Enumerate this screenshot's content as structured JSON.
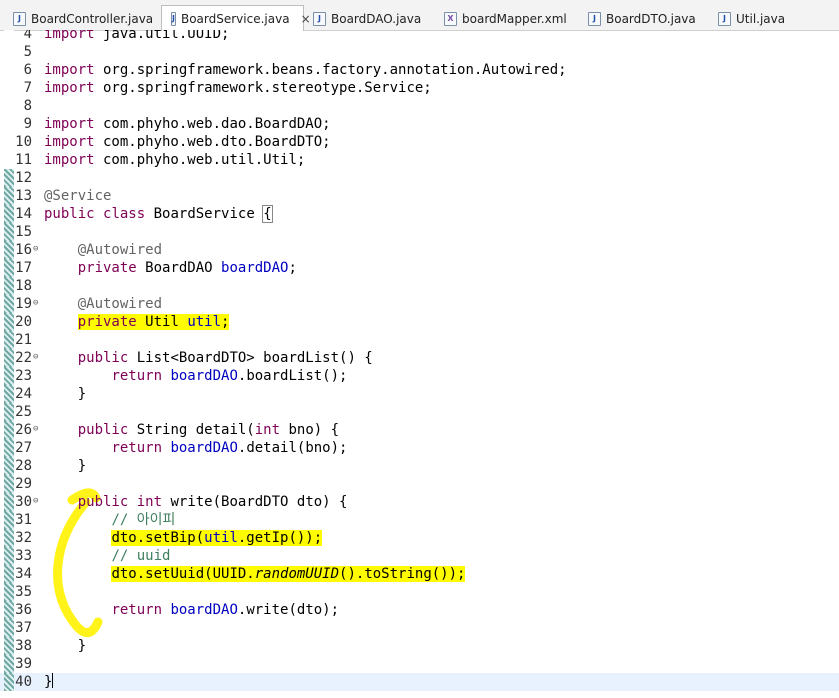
{
  "tabs": [
    {
      "label": "BoardController.java",
      "icon": "J",
      "active": false
    },
    {
      "label": "BoardService.java",
      "icon": "J",
      "active": true
    },
    {
      "label": "BoardDAO.java",
      "icon": "J",
      "active": false
    },
    {
      "label": "boardMapper.xml",
      "icon": "X",
      "active": false
    },
    {
      "label": "BoardDTO.java",
      "icon": "J",
      "active": false
    },
    {
      "label": "Util.java",
      "icon": "J",
      "active": false
    }
  ],
  "close_glyph": "×",
  "lines": [
    {
      "n": "4",
      "t": [
        [
          "kw",
          "import"
        ],
        [
          "",
          " java.util.UUID;"
        ]
      ]
    },
    {
      "n": "5",
      "t": []
    },
    {
      "n": "6",
      "t": [
        [
          "kw",
          "import"
        ],
        [
          "",
          " org.springframework.beans.factory.annotation.Autowired;"
        ]
      ]
    },
    {
      "n": "7",
      "t": [
        [
          "kw",
          "import"
        ],
        [
          "",
          " org.springframework.stereotype.Service;"
        ]
      ]
    },
    {
      "n": "8",
      "t": []
    },
    {
      "n": "9",
      "t": [
        [
          "kw",
          "import"
        ],
        [
          "",
          " com.phyho.web.dao.BoardDAO;"
        ]
      ]
    },
    {
      "n": "10",
      "t": [
        [
          "kw",
          "import"
        ],
        [
          "",
          " com.phyho.web.dto.BoardDTO;"
        ]
      ]
    },
    {
      "n": "11",
      "t": [
        [
          "kw",
          "import"
        ],
        [
          "",
          " com.phyho.web.util.Util;"
        ]
      ]
    },
    {
      "n": "12",
      "t": [],
      "mark": true
    },
    {
      "n": "13",
      "t": [
        [
          "ann",
          "@Service"
        ]
      ],
      "mark": true
    },
    {
      "n": "14",
      "t": [
        [
          "kw",
          "public"
        ],
        [
          "",
          " "
        ],
        [
          "kw",
          "class"
        ],
        [
          "",
          " BoardService "
        ],
        [
          "brk",
          "{"
        ]
      ],
      "mark": true
    },
    {
      "n": "15",
      "t": [],
      "mark": true
    },
    {
      "n": "16",
      "t": [
        [
          "",
          "    "
        ],
        [
          "ann",
          "@Autowired"
        ]
      ],
      "fold": true,
      "mark": true
    },
    {
      "n": "17",
      "t": [
        [
          "",
          "    "
        ],
        [
          "kw",
          "private"
        ],
        [
          "",
          " BoardDAO "
        ],
        [
          "fld",
          "boardDAO"
        ],
        [
          "",
          ";"
        ]
      ],
      "mark": true
    },
    {
      "n": "18",
      "t": [],
      "mark": true
    },
    {
      "n": "19",
      "t": [
        [
          "",
          "    "
        ],
        [
          "ann",
          "@Autowired"
        ]
      ],
      "fold": true,
      "mark": true
    },
    {
      "n": "20",
      "t": [
        [
          "",
          "    "
        ],
        [
          "kw hl",
          "private"
        ],
        [
          "hl",
          " Util "
        ],
        [
          "fld hl",
          "util"
        ],
        [
          "hl",
          ";"
        ]
      ],
      "mark": true
    },
    {
      "n": "21",
      "t": [],
      "mark": true
    },
    {
      "n": "22",
      "t": [
        [
          "",
          "    "
        ],
        [
          "kw",
          "public"
        ],
        [
          "",
          " List<BoardDTO> boardList() {"
        ]
      ],
      "fold": true,
      "mark": true
    },
    {
      "n": "23",
      "t": [
        [
          "",
          "        "
        ],
        [
          "kw",
          "return"
        ],
        [
          "",
          " "
        ],
        [
          "fld",
          "boardDAO"
        ],
        [
          "",
          ".boardList();"
        ]
      ],
      "mark": true
    },
    {
      "n": "24",
      "t": [
        [
          "",
          "    }"
        ]
      ],
      "mark": true
    },
    {
      "n": "25",
      "t": [],
      "mark": true
    },
    {
      "n": "26",
      "t": [
        [
          "",
          "    "
        ],
        [
          "kw",
          "public"
        ],
        [
          "",
          " String detail("
        ],
        [
          "kw",
          "int"
        ],
        [
          "",
          " bno) {"
        ]
      ],
      "fold": true,
      "mark": true
    },
    {
      "n": "27",
      "t": [
        [
          "",
          "        "
        ],
        [
          "kw",
          "return"
        ],
        [
          "",
          " "
        ],
        [
          "fld",
          "boardDAO"
        ],
        [
          "",
          ".detail(bno);"
        ]
      ],
      "mark": true
    },
    {
      "n": "28",
      "t": [
        [
          "",
          "    }"
        ]
      ],
      "mark": true
    },
    {
      "n": "29",
      "t": [],
      "mark": true
    },
    {
      "n": "30",
      "t": [
        [
          "",
          "    "
        ],
        [
          "kw",
          "public"
        ],
        [
          "",
          " "
        ],
        [
          "kw",
          "int"
        ],
        [
          "",
          " write(BoardDTO dto) {"
        ]
      ],
      "fold": true,
      "mark": true
    },
    {
      "n": "31",
      "t": [
        [
          "",
          "        "
        ],
        [
          "cmt",
          "// 아이피"
        ]
      ],
      "mark": true
    },
    {
      "n": "32",
      "t": [
        [
          "",
          "        "
        ],
        [
          "hl",
          "dto.setBip("
        ],
        [
          "fld hl",
          "util"
        ],
        [
          "hl",
          ".getIp());"
        ]
      ],
      "mark": true
    },
    {
      "n": "33",
      "t": [
        [
          "",
          "        "
        ],
        [
          "cmt",
          "// uuid"
        ]
      ],
      "mark": true
    },
    {
      "n": "34",
      "t": [
        [
          "",
          "        "
        ],
        [
          "hl",
          "dto.setUuid(UUID."
        ],
        [
          "ital hl",
          "randomUUID"
        ],
        [
          "hl",
          "().toString());"
        ]
      ],
      "mark": true
    },
    {
      "n": "35",
      "t": [],
      "mark": true
    },
    {
      "n": "36",
      "t": [
        [
          "",
          "        "
        ],
        [
          "kw",
          "return"
        ],
        [
          "",
          " "
        ],
        [
          "fld",
          "boardDAO"
        ],
        [
          "",
          ".write(dto);"
        ]
      ],
      "mark": true
    },
    {
      "n": "37",
      "t": [],
      "mark": true
    },
    {
      "n": "38",
      "t": [
        [
          "",
          "    }"
        ]
      ],
      "mark": true
    },
    {
      "n": "39",
      "t": [],
      "mark": true
    },
    {
      "n": "40",
      "t": [
        [
          "",
          "}"
        ],
        [
          "cursor",
          ""
        ]
      ],
      "mark": true,
      "current": true
    }
  ]
}
